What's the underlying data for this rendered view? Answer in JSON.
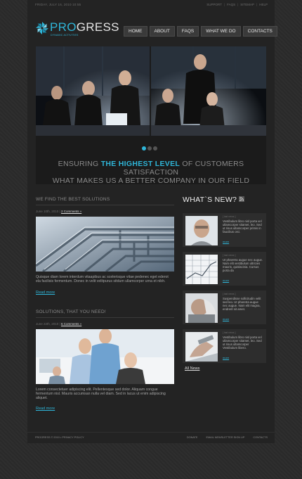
{
  "topbar": {
    "date": "FRIDAY, JULY 16, 2010 10:55",
    "links": [
      "SUPPORT",
      "FAQS",
      "SITEMAP",
      "HELP"
    ]
  },
  "logo": {
    "pro": "PRO",
    "gress": "GRESS",
    "tagline": "DYNAMIC ACTIVITIES"
  },
  "nav": [
    "HOME",
    "ABOUT",
    "FAQS",
    "WHAT WE DO",
    "CONTACTS"
  ],
  "slider": {
    "tagline_pre": "ENSURING",
    "tagline_hl": "THE HIGHEST LEVEL",
    "tagline_post": "OF CUSTOMERS SATISFACTION",
    "tagline_line2": "WHAT MAKES US A BETTER COMPANY IN OUR FIELD",
    "active_slide": 1,
    "slide_count": 3
  },
  "articles": [
    {
      "title": "WE FIND THE BEST SOLUTIONS",
      "date": "June 10th, 2010 |",
      "comments": "2 Comments »",
      "text": "Quisque diam lorem interdum vitaapibus ac scelerisque vitae pedenec eget ederot ela facilisis fermentum. Donec in velit velitpurus sitdum ullamcorper urna et nibh.",
      "more": "Read more"
    },
    {
      "title": "SOLUTIONS, THAT YOU NEED!",
      "date": "June 22th, 2010 |",
      "comments": "6 Comments »",
      "text": "Lorem consectetuer adipiscing elit. Pellentesque sed dolor. Aliquam congue fermentum nisl. Mauris accumsan nulla vel diam. Sed in lacus ut enim adipiscing aliquet.",
      "more": "Read more"
    }
  ],
  "sidebar": {
    "title": "WHAT`S NEW?",
    "news": [
      {
        "date": "[ last news ]",
        "text": "Vestibulum libro nisl porta vel ullamcorper sitamet, leo. Sed ut risus ullamcorper primis in faucibus orci.",
        "more": "more"
      },
      {
        "date": "[ last news ]",
        "text": "Ut pharetra augue nec augue. Nam elit vestibulum ultricies mauris, quislacinia. Cursus porta da",
        "more": "more"
      },
      {
        "date": "[ last news ]",
        "text": "Suspendisse sollicitudin velit sed leo. Ut pharetra augue nec augue. Nam elit magna, endrerit sit amet.",
        "more": "more"
      },
      {
        "date": "[ last news ]",
        "text": "Vestibulum libro nisl porta vel ullamcorper sitamet, leo. Sed ut risus ullamcorper Vestibulum libero.",
        "more": "more"
      }
    ],
    "all_news": "All News"
  },
  "footer": {
    "copy": "PROGRESS © 2010 • PRIVACY POLICY",
    "links": [
      "DONATE",
      "EMAIL NEWSLETTER SIGN UP",
      "CONTACTS"
    ]
  },
  "colors": {
    "accent": "#2fb6d9",
    "background": "#2b2b2b",
    "panel": "#232323"
  }
}
